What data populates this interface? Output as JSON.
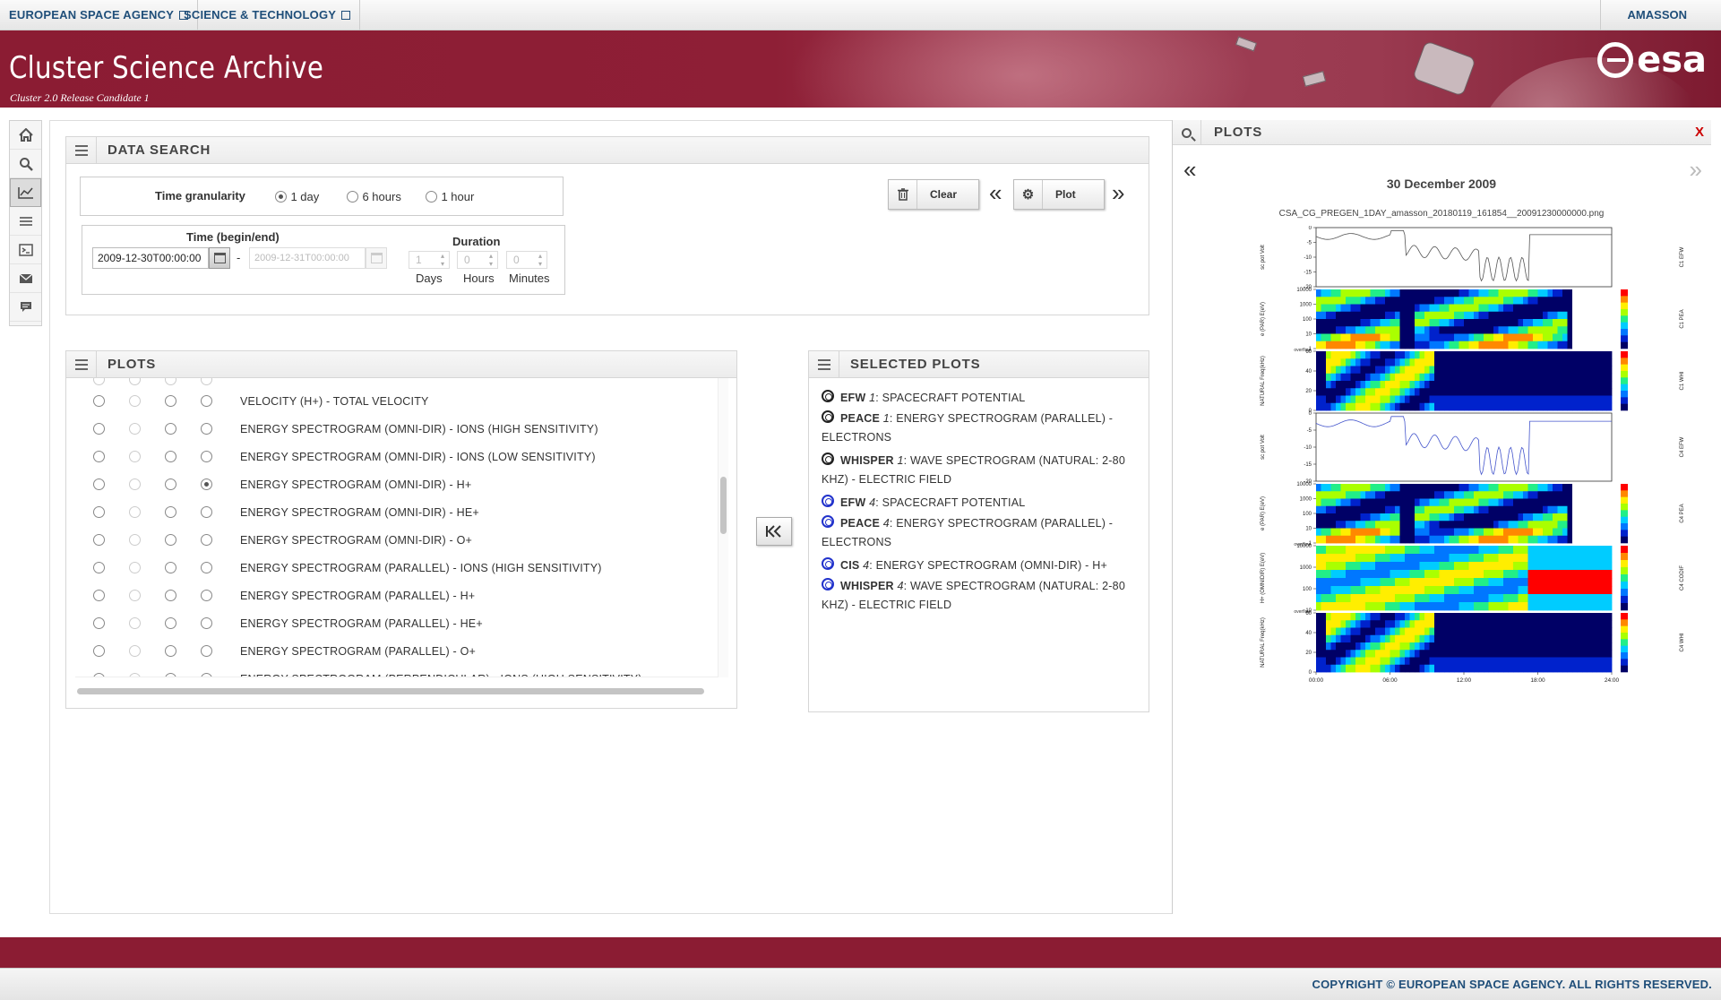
{
  "topbar": {
    "link1": "EUROPEAN SPACE AGENCY",
    "link2": "SCIENCE & TECHNOLOGY",
    "user": "AMASSON"
  },
  "banner": {
    "title": "Cluster Science Archive",
    "subtitle": "Cluster 2.0 Release Candidate 1",
    "logo_text": "esa"
  },
  "sidebar_icons": [
    "home-icon",
    "search-icon",
    "chart-icon",
    "list-icon",
    "terminal-icon",
    "mail-icon",
    "chat-icon"
  ],
  "data_search": {
    "title": "DATA SEARCH",
    "granularity_label": "Time granularity",
    "granularity_options": [
      "1 day",
      "6 hours",
      "1 hour"
    ],
    "granularity_selected": "1 day",
    "time_label": "Time (begin/end)",
    "begin_value": "2009-12-30T00:00:00",
    "end_value": "2009-12-31T00:00:00",
    "range_separator": "-",
    "duration_label": "Duration",
    "days_value": "1",
    "hours_value": "0",
    "minutes_value": "0",
    "days_label": "Days",
    "hours_label": "Hours",
    "minutes_label": "Minutes",
    "clear_label": "Clear",
    "plot_label": "Plot"
  },
  "plots": {
    "title": "PLOTS",
    "rows": [
      {
        "label": "VELOCITY (H+) - TOTAL VELOCITY",
        "selected_col": -1
      },
      {
        "label": "ENERGY SPECTROGRAM (OMNI-DIR) - IONS (HIGH SENSITIVITY)",
        "selected_col": -1
      },
      {
        "label": "ENERGY SPECTROGRAM (OMNI-DIR) - IONS (LOW SENSITIVITY)",
        "selected_col": -1
      },
      {
        "label": "ENERGY SPECTROGRAM (OMNI-DIR) - H+",
        "selected_col": 3
      },
      {
        "label": "ENERGY SPECTROGRAM (OMNI-DIR) - HE+",
        "selected_col": -1
      },
      {
        "label": "ENERGY SPECTROGRAM (OMNI-DIR) - O+",
        "selected_col": -1
      },
      {
        "label": "ENERGY SPECTROGRAM (PARALLEL) - IONS (HIGH SENSITIVITY)",
        "selected_col": -1
      },
      {
        "label": "ENERGY SPECTROGRAM (PARALLEL) - H+",
        "selected_col": -1
      },
      {
        "label": "ENERGY SPECTROGRAM (PARALLEL) - HE+",
        "selected_col": -1
      },
      {
        "label": "ENERGY SPECTROGRAM (PARALLEL) - O+",
        "selected_col": -1
      },
      {
        "label": "ENERGY SPECTROGRAM (PERPENDICULAR) - IONS (HIGH SENSITIVITY)",
        "selected_col": -1
      }
    ]
  },
  "selected_plots": {
    "title": "SELECTED PLOTS",
    "items": [
      {
        "instrument": "EFW",
        "sc": "1",
        "desc": ": SPACECRAFT POTENTIAL",
        "color": "black"
      },
      {
        "instrument": "PEACE",
        "sc": "1",
        "desc": ": ENERGY SPECTROGRAM (PARALLEL) - ELECTRONS",
        "color": "black"
      },
      {
        "instrument": "WHISPER",
        "sc": "1",
        "desc": ": WAVE SPECTROGRAM (NATURAL: 2-80 KHZ) - ELECTRIC FIELD",
        "color": "black"
      },
      {
        "instrument": "EFW",
        "sc": "4",
        "desc": ": SPACECRAFT POTENTIAL",
        "color": "blue"
      },
      {
        "instrument": "PEACE",
        "sc": "4",
        "desc": ": ENERGY SPECTROGRAM (PARALLEL) - ELECTRONS",
        "color": "blue"
      },
      {
        "instrument": "CIS",
        "sc": "4",
        "desc": ": ENERGY SPECTROGRAM (OMNI-DIR) - H+",
        "color": "blue"
      },
      {
        "instrument": "WHISPER",
        "sc": "4",
        "desc": ": WAVE SPECTROGRAM (NATURAL: 2-80 KHZ) - ELECTRIC FIELD",
        "color": "blue"
      }
    ]
  },
  "plot_viewer": {
    "title": "PLOTS",
    "close_label": "X",
    "date": "30 December 2009",
    "filename": "CSA_CG_PREGEN_1DAY_amasson_20180119_161854__20091230000000.png",
    "x_ticks": [
      "00:00",
      "06:00",
      "12:00",
      "18:00",
      "24:00"
    ],
    "panels": [
      {
        "kind": "line",
        "ylabel": "sc pot Volt",
        "rlabel": "C1 EFW",
        "ticks": [
          "0",
          "-5",
          "-10",
          "-15",
          "-20"
        ],
        "color": "#555"
      },
      {
        "kind": "spec",
        "ylabel": "e (PAR) E(eV)",
        "rlabel": "C1 PEA",
        "ticks": [
          "10000",
          "1000",
          "100",
          "10",
          "1"
        ]
      },
      {
        "kind": "wave",
        "ylabel": "NATURAL Freq(kHz)",
        "rlabel": "C1 WHI",
        "ticks": [
          "60",
          "40",
          "20",
          "0"
        ]
      },
      {
        "kind": "line",
        "ylabel": "sc pot Volt",
        "rlabel": "C4 EFW",
        "ticks": [
          "0",
          "-5",
          "-10",
          "-15",
          "-20"
        ],
        "color": "#4455cc"
      },
      {
        "kind": "spec",
        "ylabel": "e (PAR) E(eV)",
        "rlabel": "C4 PEA",
        "ticks": [
          "10000",
          "1000",
          "100",
          "10",
          "1"
        ]
      },
      {
        "kind": "hplus",
        "ylabel": "H+ (OMNIDIR) E(eV)",
        "rlabel": "C4 CODIF",
        "ticks": [
          "10000",
          "1000",
          "100",
          "10"
        ]
      },
      {
        "kind": "wave",
        "ylabel": "NATURAL Freq(kHz)",
        "rlabel": "C4 WHI",
        "ticks": [
          "60",
          "40",
          "20",
          "0"
        ]
      }
    ],
    "overflow_label": "overflow"
  },
  "footer": {
    "copyright": "COPYRIGHT © EUROPEAN SPACE AGENCY. ALL RIGHTS RESERVED."
  }
}
